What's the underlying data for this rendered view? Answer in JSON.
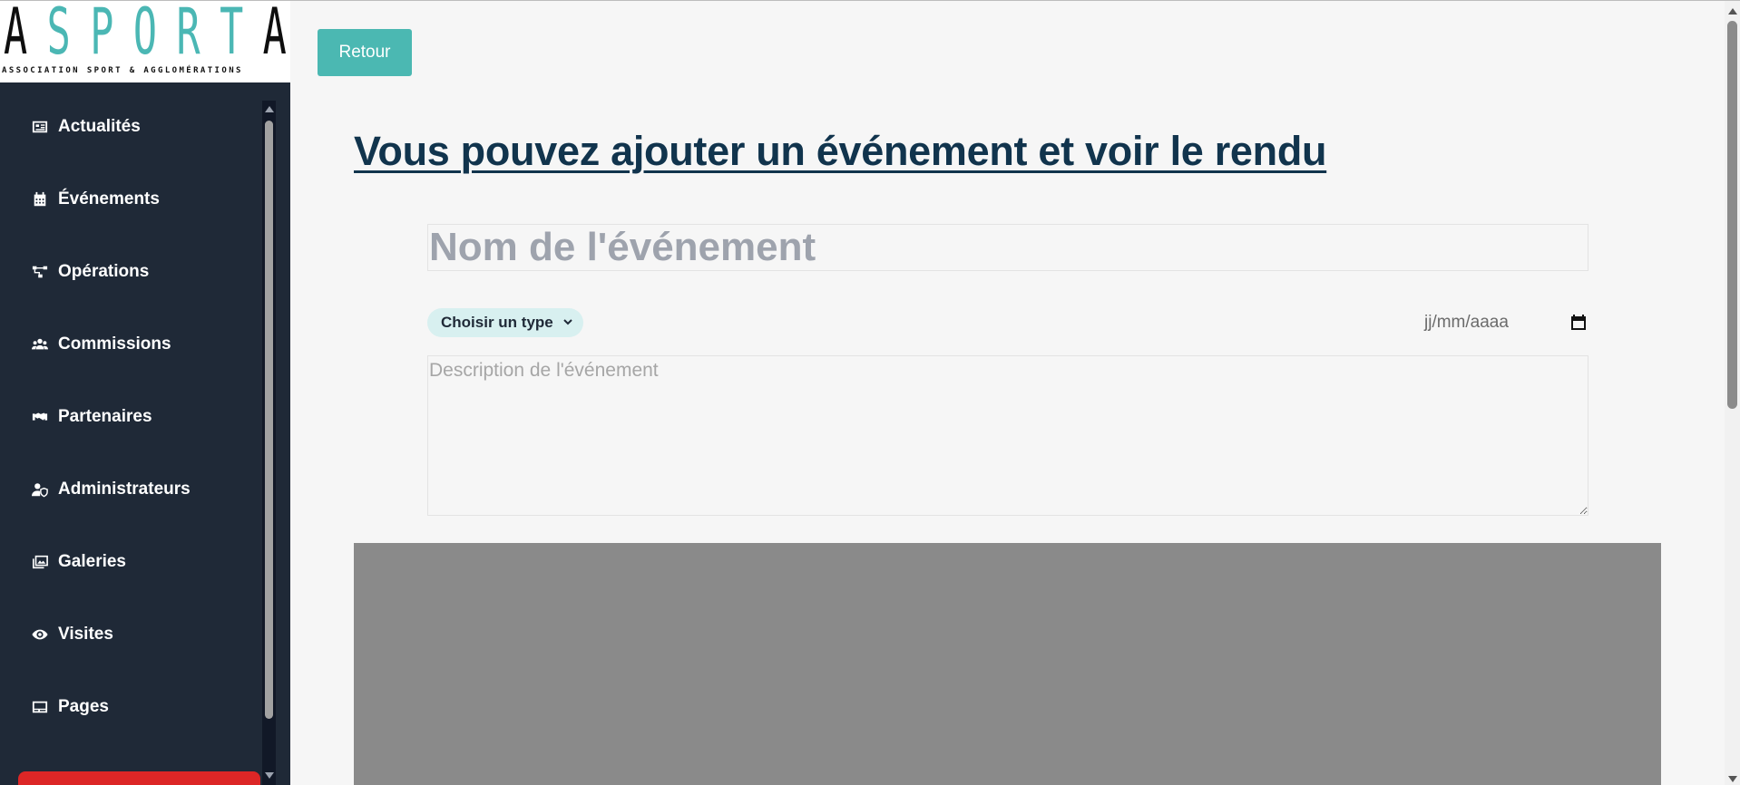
{
  "logo": {
    "word_letters": [
      "A",
      "S",
      "P",
      "O",
      "R",
      "T",
      "A"
    ],
    "tagline": "ASSOCIATION SPORT & AGGLOMÉRATIONS"
  },
  "sidebar": {
    "items": [
      {
        "label": "Actualités",
        "icon": "newspaper-icon"
      },
      {
        "label": "Événements",
        "icon": "calendar-icon"
      },
      {
        "label": "Opérations",
        "icon": "sitemap-icon"
      },
      {
        "label": "Commissions",
        "icon": "users-icon"
      },
      {
        "label": "Partenaires",
        "icon": "handshake-icon"
      },
      {
        "label": "Administrateurs",
        "icon": "user-shield-icon"
      },
      {
        "label": "Galeries",
        "icon": "images-icon"
      },
      {
        "label": "Visites",
        "icon": "eye-icon"
      },
      {
        "label": "Pages",
        "icon": "page-card-icon"
      }
    ]
  },
  "toolbar": {
    "back_label": "Retour"
  },
  "main": {
    "title": "Vous pouvez ajouter un événement et voir le rendu",
    "name_placeholder": "Nom de l'événement",
    "type_select": "Choisir un type",
    "date_placeholder": "jj/mm/aaaa",
    "description_placeholder": "Description de l'événement"
  },
  "colors": {
    "sidebar_bg": "#1f2937",
    "accent": "#4bb8b2",
    "title": "#11344d",
    "danger": "#dc2626",
    "preview_bg": "#8a8a8a"
  }
}
